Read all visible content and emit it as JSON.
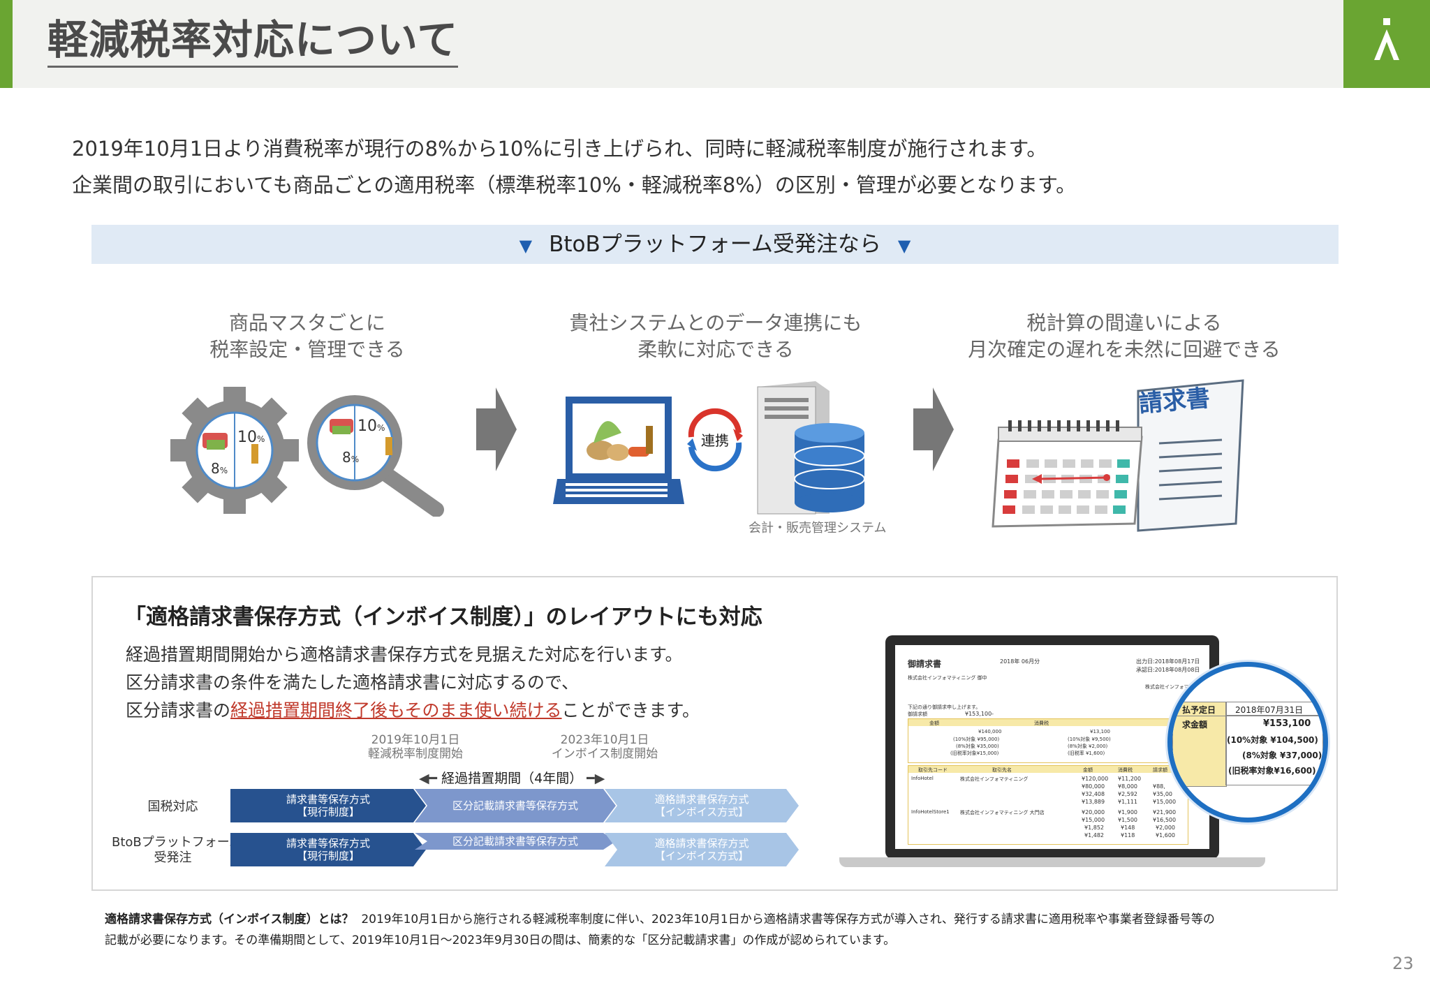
{
  "header": {
    "title": "軽減税率対応について",
    "accent_color": "#6aa532",
    "logo_icon": "logo-icon"
  },
  "intro": {
    "line1": "2019年10月1日より消費税率が現行の8%から10%に引き上げられ、同時に軽減税率制度が施行されます。",
    "line2": "企業間の取引においても商品ごとの適用税率（標準税率10%・軽減税率8%）の区別・管理が必要となります。"
  },
  "banner": {
    "text": "BtoBプラットフォーム受発注なら",
    "icon": "triangle-down-icon"
  },
  "features": [
    {
      "line1": "商品マスタごとに",
      "line2": "税率設定・管理できる",
      "badge_10": "10",
      "badge_8": "8",
      "unit": "%"
    },
    {
      "line1": "貴社システムとのデータ連携にも",
      "line2": "柔軟に対応できる",
      "link_label": "連携",
      "system_label": "会計・販売管理システム"
    },
    {
      "line1": "税計算の間違いによる",
      "line2": "月次確定の遅れを未然に回避できる",
      "doc_label": "請求書"
    }
  ],
  "invoice_section": {
    "title": "「適格請求書保存方式（インボイス制度）」のレイアウトにも対応",
    "body1": "経過措置期間開始から適格請求書保存方式を見据えた対応を行います。",
    "body2": "区分請求書の条件を満たした適格請求書に対応するので、",
    "body3_pre": "区分請求書の",
    "body3_em": "経過措置期間終了後もそのまま使い続ける",
    "body3_post": "ことができます。",
    "timeline": {
      "date1": "2019年10月1日",
      "date1_sub": "軽減税率制度開始",
      "date2": "2023年10月1日",
      "date2_sub": "インボイス制度開始",
      "period": "経過措置期間（4年間）",
      "rows": [
        {
          "label1": "国税対応",
          "label2": "",
          "b1a": "請求書等保存方式",
          "b1b": "【現行制度】",
          "b2": "区分記載請求書等保存方式",
          "b3a": "適格請求書保存方式",
          "b3b": "【インボイス方式】"
        },
        {
          "label1": "BtoBプラットフォーム",
          "label2": "受発注",
          "b1a": "請求書等保存方式",
          "b1b": "【現行制度】",
          "b2": "区分記載請求書等保存方式",
          "b3a": "適格請求書保存方式",
          "b3b": "【インボイス方式】"
        }
      ]
    },
    "screenshot": {
      "doc_title": "御請求書",
      "period": "2018年 06月分",
      "issue_date": "出力日:2018年08月17日",
      "approve_date": "承認日:2018年08月08日",
      "to": "株式会社インフォマティニング 御中",
      "from": "株式会社インフォマ",
      "note": "下記の通り御請求申し上げます。",
      "amount_label": "御請求額",
      "amount": "¥153,100-",
      "cells": [
        "金額",
        "¥140,000",
        "(10%対象 ¥95,000)",
        "(8%対象 ¥35,000)",
        "(旧税率対象¥15,000)",
        "消費税",
        "¥13,100",
        "(10%対象 ¥9,500)",
        "(8%対象 ¥2,000)",
        "(旧税率 ¥1,600)"
      ],
      "rows_hdr": [
        "取引先コード",
        "取引先名",
        "金額",
        "消費税",
        "請求額"
      ],
      "row_codes": [
        "InfoHotel",
        "InfoHotelStore1"
      ],
      "row_names": [
        "株式会社インフォマティニング",
        "株式会社インフォマティニング 大門店"
      ],
      "amounts": [
        "¥120,000",
        "¥80,000",
        "¥32,408",
        "¥13,889",
        "¥20,000",
        "¥15,000",
        "¥1,852",
        "¥1,482"
      ],
      "taxes": [
        "¥11,200",
        "¥8,000",
        "¥2,592",
        "¥1,111",
        "¥1,900",
        "¥1,500",
        "¥148",
        "¥118"
      ],
      "totals": [
        "¥88,",
        "¥35,00",
        "¥15,000",
        "¥21,900",
        "¥16,500",
        "¥2,000",
        "¥1,600"
      ],
      "zoom": {
        "due_label": "払予定日",
        "due_date": "2018年07月31日",
        "total_label": "求金額",
        "total": "¥153,100",
        "t10": "(10%対象 ¥104,500)",
        "t8": "(8%対象 ¥37,000)",
        "old": "(旧税率対象¥16,600)"
      }
    }
  },
  "footnote": {
    "bold": "適格請求書保存方式（インボイス制度）とは？",
    "line1": "2019年10月1日から施行される軽減税率制度に伴い、2023年10月1日から適格請求書等保存方式が導入され、発行する請求書に適用税率や事業者登録番号等の",
    "line2": "記載が必要になります。その準備期間として、2019年10月1日～2023年9月30日の間は、簡素的な「区分記載請求書」の作成が認められています。"
  },
  "page_number": "23"
}
